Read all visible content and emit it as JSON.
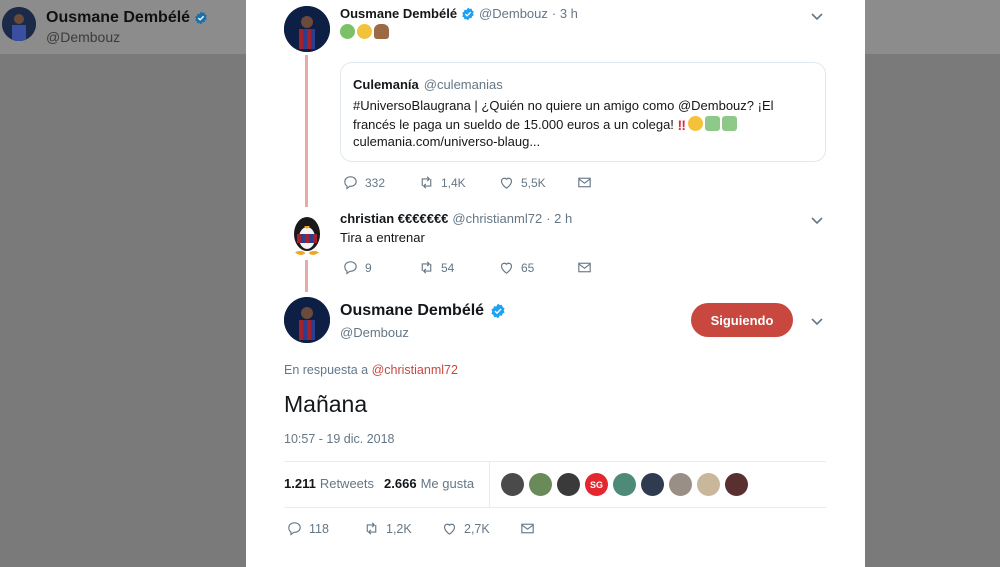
{
  "background_profile": {
    "name": "Ousmane Dembélé",
    "handle": "@Dembouz"
  },
  "tweets": [
    {
      "name": "Ousmane Dembélé",
      "handle": "@Dembouz",
      "time": "· 3 h",
      "emojis": [
        "nauseated-face",
        "tired-face",
        "pile-of-poo"
      ],
      "quote": {
        "name": "Culemanía",
        "handle": "@culemanias",
        "text": "#UniversoBlaugrana | ¿Quién no quiere un amigo como @Dembouz? ¡El francés le paga un sueldo de 15.000 euros a un colega!",
        "text_emojis": [
          "double-exclamation",
          "rolling-laughing-face",
          "money-with-wings",
          "money-with-wings"
        ],
        "link": "culemania.com/universo-blaug..."
      },
      "actions": {
        "replies": "332",
        "retweets": "1,4K",
        "likes": "5,5K"
      }
    },
    {
      "name": "christian €€€€€€€",
      "handle": "@christianml72",
      "time": "· 2 h",
      "text": "Tira a entrenar",
      "actions": {
        "replies": "9",
        "retweets": "54",
        "likes": "65"
      }
    }
  ],
  "main_tweet": {
    "name": "Ousmane Dembélé",
    "handle": "@Dembouz",
    "follow_label": "Siguiendo",
    "reply_prefix": "En respuesta a",
    "reply_to": "@christianml72",
    "text": "Mañana",
    "timestamp": "10:57 - 19 dic. 2018",
    "retweets_count": "1.211",
    "retweets_label": "Retweets",
    "likes_count": "2.666",
    "likes_label": "Me gusta",
    "liker_badge": "SG",
    "actions": {
      "replies": "118",
      "retweets": "1,2K",
      "likes": "2,7K"
    }
  },
  "colors": {
    "accent": "#c8473e",
    "thread_line": "#e8a9a9",
    "muted": "#657786",
    "verified": "#1da1f2"
  }
}
